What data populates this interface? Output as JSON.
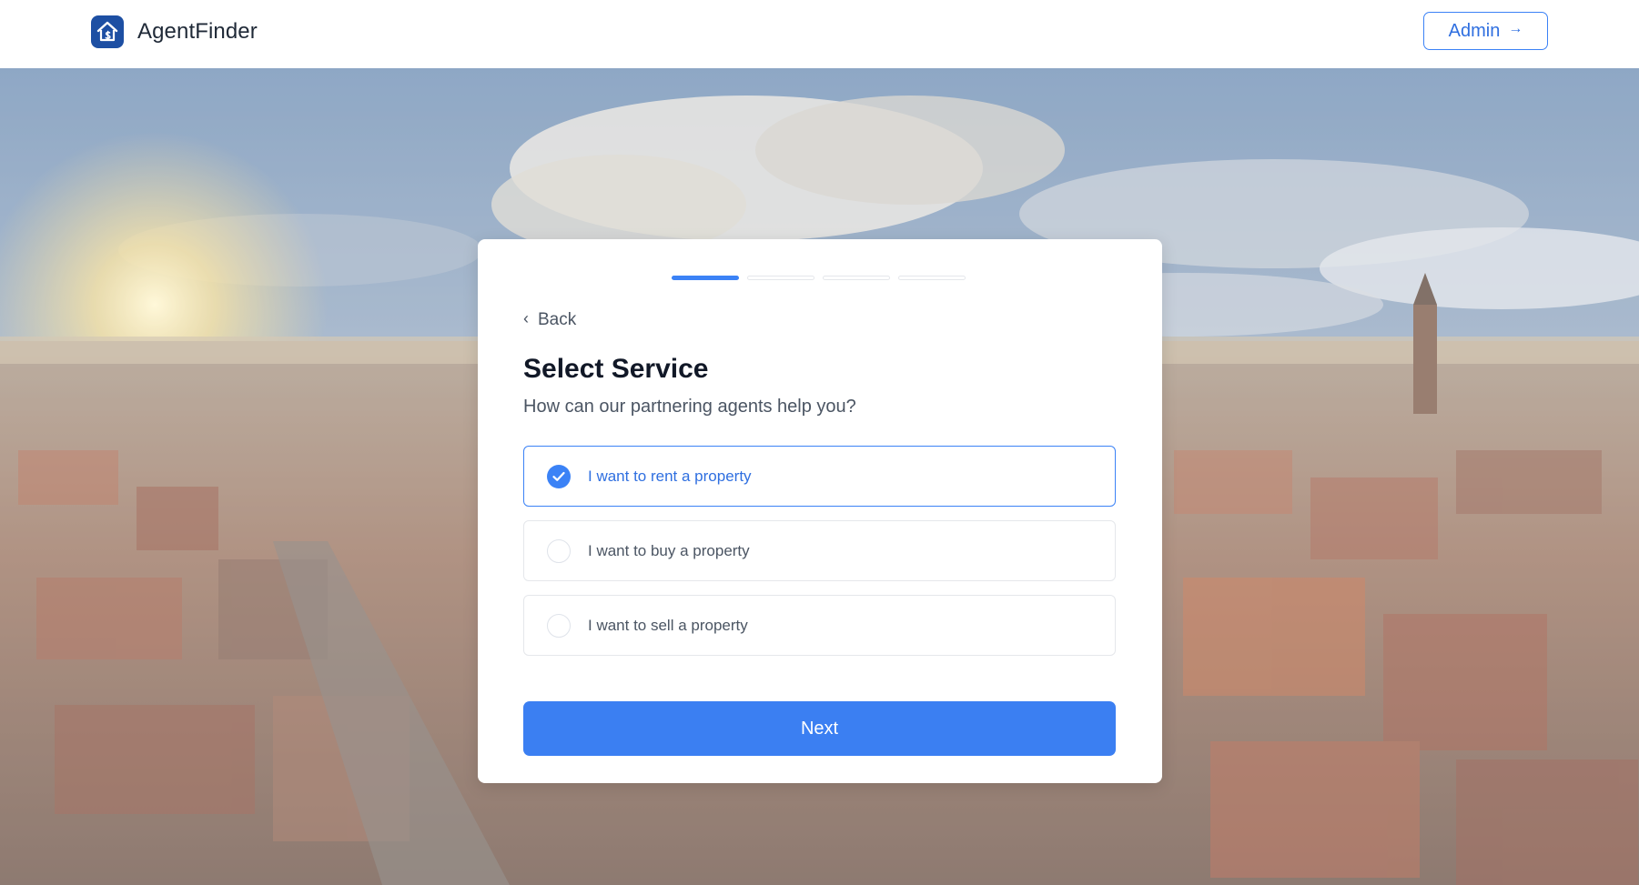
{
  "header": {
    "brand_name": "AgentFinder",
    "logo_icon": "house-dollar-icon",
    "admin_label": "Admin",
    "admin_icon": "arrow-right-icon"
  },
  "progress": {
    "total_steps": 4,
    "current_step": 1
  },
  "card": {
    "back_label": "Back",
    "title": "Select Service",
    "subtitle": "How can our partnering agents help you?",
    "options": [
      {
        "label": "I want to rent a property",
        "selected": true
      },
      {
        "label": "I want to buy a property",
        "selected": false
      },
      {
        "label": "I want to sell a property",
        "selected": false
      }
    ],
    "next_label": "Next"
  },
  "colors": {
    "accent": "#3b82f6",
    "brand_logo": "#1d4fa3",
    "title": "#111827",
    "muted_text": "#4b5563"
  }
}
